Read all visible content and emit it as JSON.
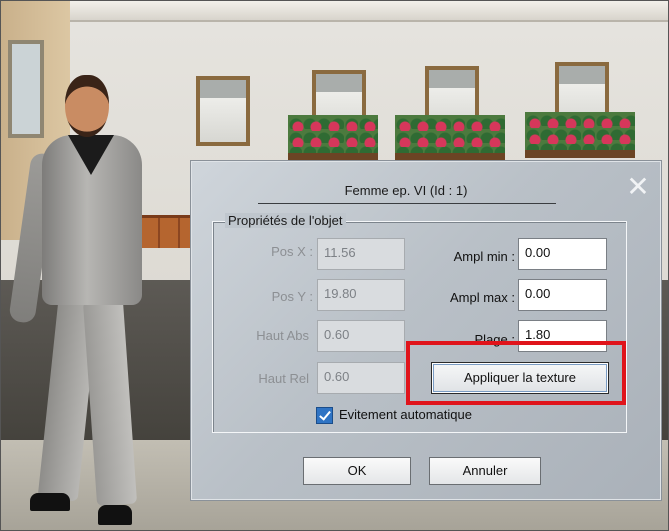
{
  "dialog": {
    "title": "Femme ep. VI (Id : 1)",
    "close_icon": "close-icon",
    "group_title": "Propriétés de l'objet",
    "fields": {
      "pos_x": {
        "label": "Pos X :",
        "value": "11.56",
        "enabled": false
      },
      "pos_y": {
        "label": "Pos Y :",
        "value": "19.80",
        "enabled": false
      },
      "haut_abs": {
        "label": "Haut Abs",
        "value": "0.60",
        "enabled": false
      },
      "haut_rel": {
        "label": "Haut Rel",
        "value": "0.60",
        "enabled": false
      },
      "ampl_min": {
        "label": "Ampl min :",
        "value": "0.00",
        "enabled": true
      },
      "ampl_max": {
        "label": "Ampl max :",
        "value": "0.00",
        "enabled": true
      },
      "plage": {
        "label": "Plage :",
        "value": "1.80",
        "enabled": true
      }
    },
    "apply_texture_label": "Appliquer la texture",
    "checkbox": {
      "label": "Evitement automatique",
      "checked": true
    },
    "ok_label": "OK",
    "cancel_label": "Annuler"
  },
  "colors": {
    "highlight": "#e0141b",
    "checkbox_accent": "#2f74c4"
  }
}
